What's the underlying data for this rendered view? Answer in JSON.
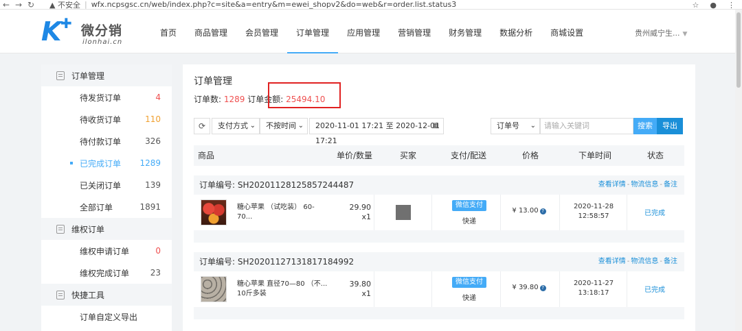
{
  "browser": {
    "security_label": "▲ 不安全",
    "url": "wfx.ncpsgsc.cn/web/index.php?c=site&a=entry&m=ewei_shopv2&do=web&r=order.list.status3"
  },
  "logo": {
    "name": "微分销",
    "domain": "ilonhai.cn"
  },
  "menu": [
    "首页",
    "商品管理",
    "会员管理",
    "订单管理",
    "应用管理",
    "营销管理",
    "财务管理",
    "数据分析",
    "商城设置"
  ],
  "shop_name": "贵州威宁生...",
  "sidebar": {
    "groups": [
      {
        "title": "订单管理",
        "items": [
          {
            "label": "待发货订单",
            "count": "4",
            "count_color": "#ef4f4f"
          },
          {
            "label": "待收货订单",
            "count": "110",
            "count_color": "#f0a030"
          },
          {
            "label": "待付款订单",
            "count": "326",
            "count_color": "#555555"
          },
          {
            "label": "已完成订单",
            "count": "1289",
            "count_color": "#44abf7",
            "active": true
          },
          {
            "label": "已关闭订单",
            "count": "139",
            "count_color": "#555555"
          },
          {
            "label": "全部订单",
            "count": "1891",
            "count_color": "#555555"
          }
        ]
      },
      {
        "title": "维权订单",
        "items": [
          {
            "label": "维权申请订单",
            "count": "0",
            "count_color": "#ef4f4f"
          },
          {
            "label": "维权完成订单",
            "count": "23",
            "count_color": "#555555"
          }
        ]
      },
      {
        "title": "快捷工具",
        "items": [
          {
            "label": "订单自定义导出",
            "count": ""
          }
        ]
      }
    ]
  },
  "main": {
    "title": "订单管理",
    "summary": {
      "count_label": "订单数:",
      "count": "1289",
      "amount_label": "订单金额:",
      "amount": "25494.10"
    },
    "filter": {
      "pay_method": "支付方式",
      "time_type": "不按时间",
      "date_range": "2020-11-01 17:21 至 2020-12-01 17:21",
      "search_field": "订单号",
      "keyword_placeholder": "请输入关键词",
      "search_label": "搜索",
      "export_label": "导出"
    },
    "columns": [
      "商品",
      "单价/数量",
      "买家",
      "支付/配送",
      "价格",
      "下单时间",
      "状态"
    ],
    "orders": [
      {
        "order_no_label": "订单编号: SH20201128125857244487",
        "links": [
          "查看详情",
          "物流信息",
          "备注"
        ],
        "product": "糖心苹果 （试吃装） 60-70...",
        "unit_price": "29.90",
        "qty": "x1",
        "pay": "微信支付",
        "ship": "快递",
        "price": "¥ 13.00",
        "date": "2020-11-28",
        "time": "12:58:57",
        "status": "已完成"
      },
      {
        "order_no_label": "订单编号: SH20201127131817184992",
        "links": [
          "查看详情",
          "物流信息",
          "备注"
        ],
        "product": "糖心苹果 直径70—80 （不...\n10斤多装",
        "unit_price": "39.80",
        "qty": "x1",
        "pay": "微信支付",
        "ship": "快递",
        "price": "¥ 39.80",
        "date": "2020-11-27",
        "time": "13:18:17",
        "status": "已完成"
      }
    ]
  }
}
